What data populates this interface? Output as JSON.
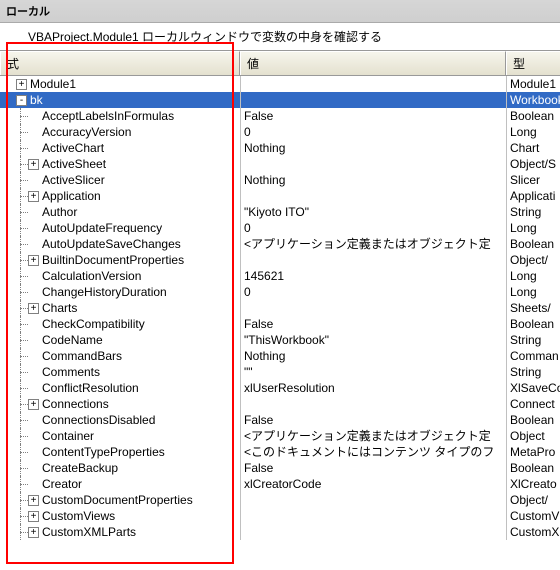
{
  "window": {
    "title": "ローカル"
  },
  "context_bar": "VBAProject.Module1  ローカルウィンドウで変数の中身を確認する",
  "columns": {
    "expr": "式",
    "value": "値",
    "type": "型"
  },
  "rows": [
    {
      "depth": 0,
      "expander": "+",
      "name": "Module1",
      "value": "",
      "type": "Module1"
    },
    {
      "depth": 0,
      "expander": "-",
      "name": "bk",
      "value": "",
      "type": "Workbook",
      "selected": true
    },
    {
      "depth": 1,
      "expander": "",
      "name": "AcceptLabelsInFormulas",
      "value": "False",
      "type": "Boolean"
    },
    {
      "depth": 1,
      "expander": "",
      "name": "AccuracyVersion",
      "value": "0",
      "type": "Long"
    },
    {
      "depth": 1,
      "expander": "",
      "name": "ActiveChart",
      "value": "Nothing",
      "type": "Chart"
    },
    {
      "depth": 1,
      "expander": "+",
      "name": "ActiveSheet",
      "value": "",
      "type": "Object/S"
    },
    {
      "depth": 1,
      "expander": "",
      "name": "ActiveSlicer",
      "value": "Nothing",
      "type": "Slicer"
    },
    {
      "depth": 1,
      "expander": "+",
      "name": "Application",
      "value": "",
      "type": "Applicati"
    },
    {
      "depth": 1,
      "expander": "",
      "name": "Author",
      "value": "\"Kiyoto ITO\"",
      "type": "String"
    },
    {
      "depth": 1,
      "expander": "",
      "name": "AutoUpdateFrequency",
      "value": "0",
      "type": "Long"
    },
    {
      "depth": 1,
      "expander": "",
      "name": "AutoUpdateSaveChanges",
      "value": "<アプリケーション定義またはオブジェクト定",
      "type": "Boolean"
    },
    {
      "depth": 1,
      "expander": "+",
      "name": "BuiltinDocumentProperties",
      "value": "",
      "type": "Object/"
    },
    {
      "depth": 1,
      "expander": "",
      "name": "CalculationVersion",
      "value": "145621",
      "type": "Long"
    },
    {
      "depth": 1,
      "expander": "",
      "name": "ChangeHistoryDuration",
      "value": "0",
      "type": "Long"
    },
    {
      "depth": 1,
      "expander": "+",
      "name": "Charts",
      "value": "",
      "type": "Sheets/"
    },
    {
      "depth": 1,
      "expander": "",
      "name": "CheckCompatibility",
      "value": "False",
      "type": "Boolean"
    },
    {
      "depth": 1,
      "expander": "",
      "name": "CodeName",
      "value": "\"ThisWorkbook\"",
      "type": "String"
    },
    {
      "depth": 1,
      "expander": "",
      "name": "CommandBars",
      "value": "Nothing",
      "type": "Comman"
    },
    {
      "depth": 1,
      "expander": "",
      "name": "Comments",
      "value": "\"\"",
      "type": "String"
    },
    {
      "depth": 1,
      "expander": "",
      "name": "ConflictResolution",
      "value": "xlUserResolution",
      "type": "XlSaveCo"
    },
    {
      "depth": 1,
      "expander": "+",
      "name": "Connections",
      "value": "",
      "type": "Connect"
    },
    {
      "depth": 1,
      "expander": "",
      "name": "ConnectionsDisabled",
      "value": "False",
      "type": "Boolean"
    },
    {
      "depth": 1,
      "expander": "",
      "name": "Container",
      "value": "<アプリケーション定義またはオブジェクト定",
      "type": "Object"
    },
    {
      "depth": 1,
      "expander": "",
      "name": "ContentTypeProperties",
      "value": "<このドキュメントにはコンテンツ タイプのフ",
      "type": "MetaPro"
    },
    {
      "depth": 1,
      "expander": "",
      "name": "CreateBackup",
      "value": "False",
      "type": "Boolean"
    },
    {
      "depth": 1,
      "expander": "",
      "name": "Creator",
      "value": "xlCreatorCode",
      "type": "XlCreato"
    },
    {
      "depth": 1,
      "expander": "+",
      "name": "CustomDocumentProperties",
      "value": "",
      "type": "Object/"
    },
    {
      "depth": 1,
      "expander": "+",
      "name": "CustomViews",
      "value": "",
      "type": "CustomV"
    },
    {
      "depth": 1,
      "expander": "+",
      "name": "CustomXMLParts",
      "value": "",
      "type": "CustomX"
    }
  ]
}
